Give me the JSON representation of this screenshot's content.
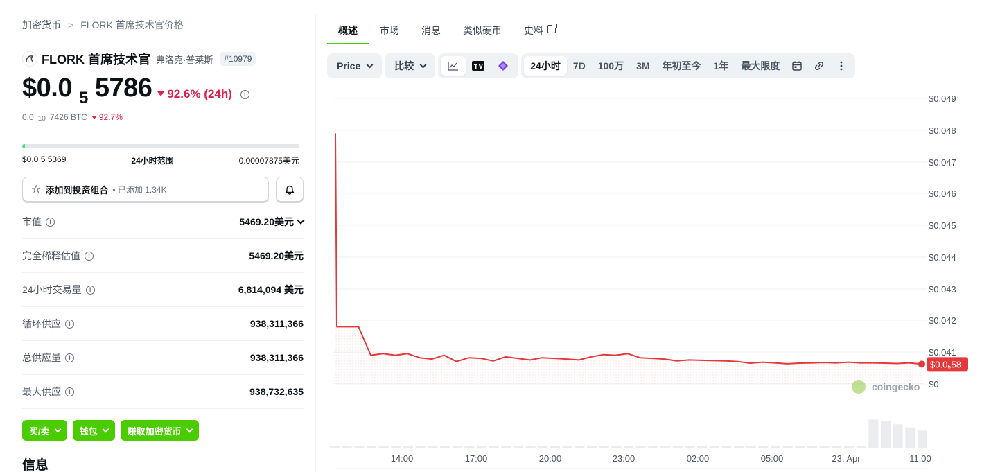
{
  "breadcrumb": {
    "root": "加密货币",
    "separator": ">",
    "current": "FLORK 首席技术官价格"
  },
  "coin": {
    "name": "FLORK 首席技术官",
    "alias": "弗洛克·普莱斯",
    "rank": "#10979",
    "price_prefix": "$0.0",
    "price_zeros": "5",
    "price_digits": "5786",
    "change_24h": "92.6% (24h)",
    "btc_prefix": "0.0",
    "btc_zeros": "10",
    "btc_digits": "7426 BTC",
    "btc_change": "92.7%"
  },
  "range": {
    "low": "$0.0 5 5369",
    "label": "24小时范围",
    "high": "0.00007875美元",
    "fill_fraction": 0.01
  },
  "portfolio": {
    "label": "添加到投资组合",
    "added": "• 已添加 1.34K"
  },
  "stats": [
    {
      "label": "市值",
      "value": "5469.20美元",
      "info": true,
      "chevron": true
    },
    {
      "label": "完全稀释估值",
      "value": "5469.20美元",
      "info": true,
      "chevron": false
    },
    {
      "label": "24小时交易量",
      "value": "6,814,094 美元",
      "info": true,
      "chevron": false
    },
    {
      "label": "循环供应",
      "value": "938,311,366",
      "info": true,
      "chevron": false
    },
    {
      "label": "总供应量",
      "value": "938,311,366",
      "info": true,
      "chevron": false
    },
    {
      "label": "最大供应",
      "value": "938,732,635",
      "info": true,
      "chevron": false
    }
  ],
  "actions": {
    "buy_sell": "买/卖",
    "wallet": "钱包",
    "earn": "赚取加密货币"
  },
  "info_heading": "信息",
  "tabs": [
    {
      "label": "概述",
      "active": true
    },
    {
      "label": "市场",
      "active": false
    },
    {
      "label": "消息",
      "active": false
    },
    {
      "label": "类似硬币",
      "active": false
    },
    {
      "label": "史料",
      "active": false,
      "external": true
    }
  ],
  "toolbar": {
    "price_label": "Price",
    "compare_label": "比较",
    "chart_icons": [
      "line-chart-icon",
      "tradingview-icon",
      "diamond-icon"
    ],
    "ranges": [
      "24小时",
      "7D",
      "100万",
      "3M",
      "年初至今",
      "1年",
      "最大限度"
    ],
    "active_range": "24小时",
    "extra_icons": [
      "calendar-icon",
      "link-icon",
      "more-icon"
    ]
  },
  "colors": {
    "accent_green": "#4bcc00",
    "down_red": "#e11d48",
    "line_red": "#e5383b"
  },
  "chart_data": {
    "type": "line",
    "y_ticks": [
      "$0.049",
      "$0.048",
      "$0.047",
      "$0.046",
      "$0.045",
      "$0.044",
      "$0.043",
      "$0.042",
      "$0.041",
      "$0"
    ],
    "x_ticks": [
      "14:00",
      "17:00",
      "20:00",
      "23:00",
      "02:00",
      "05:00",
      "23. Apr",
      "11:00"
    ],
    "current_price_label": "$0.0₅58",
    "watermark": "coingecko",
    "grid": true,
    "series": [
      {
        "values": [
          0.0479,
          0.0418,
          0.0418,
          0.0409,
          0.04095,
          0.0409,
          0.04095,
          0.04082,
          0.04078,
          0.0409,
          0.0407,
          0.04082,
          0.0408,
          0.04072,
          0.04085,
          0.0408,
          0.04075,
          0.04082,
          0.0408,
          0.04078,
          0.04075,
          0.04085,
          0.04092,
          0.0409,
          0.04095,
          0.04082,
          0.0408,
          0.04078,
          0.04072,
          0.04075,
          0.04074,
          0.04073,
          0.04072,
          0.0407,
          0.04065,
          0.04068,
          0.04066,
          0.04063,
          0.04065,
          0.04066,
          0.04067,
          0.04066,
          0.04068,
          0.04066,
          0.04066,
          0.04065,
          0.04064,
          0.04066,
          0.04062
        ]
      }
    ],
    "volume": [
      0.0,
      0.0,
      0.0,
      0.0,
      0.0,
      0.0,
      0.0,
      0.0,
      0.0,
      0.0,
      0.0,
      0.0,
      0.0,
      0.0,
      0.0,
      0.0,
      0.0,
      0.0,
      0.0,
      0.0,
      0.0,
      0.0,
      0.0,
      0.0,
      0.0,
      0.0,
      0.0,
      0.0,
      0.0,
      0.0,
      0.0,
      0.0,
      0.0,
      0.0,
      0.0,
      0.0,
      0.0,
      0.0,
      0.0,
      0.0,
      0.0,
      0.0,
      0.0,
      0.0,
      0.9,
      0.85,
      0.75,
      0.65,
      0.55
    ]
  }
}
